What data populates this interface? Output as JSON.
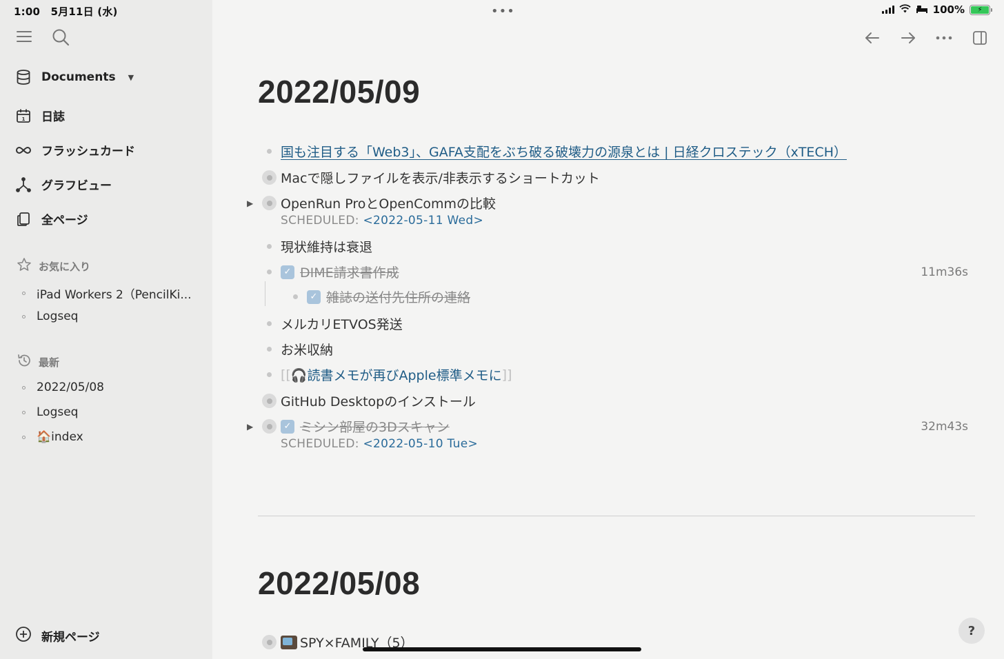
{
  "status_bar": {
    "time": "1:00",
    "date": "5月11日 (水)",
    "battery": "100%"
  },
  "sidebar": {
    "documents": "Documents",
    "nav": [
      {
        "label": "日誌",
        "icon": "calendar-icon"
      },
      {
        "label": "フラッシュカード",
        "icon": "infinity-icon"
      },
      {
        "label": "グラフビュー",
        "icon": "graph-icon"
      },
      {
        "label": "全ページ",
        "icon": "pages-icon"
      }
    ],
    "favorites": {
      "heading": "お気に入り",
      "items": [
        "iPad Workers 2（PencilKi...",
        "Logseq"
      ]
    },
    "recent": {
      "heading": "最新",
      "items": [
        "2022/05/08",
        "Logseq",
        "🏠index"
      ]
    },
    "new_page": "新規ページ"
  },
  "journals": [
    {
      "title": "2022/05/09",
      "blocks": [
        {
          "text": "国も注目する「Web3」、GAFA支配をぶち破る破壊力の源泉とは | 日経クロステック（xTECH）",
          "type": "link"
        },
        {
          "text": "Macで隠しファイルを表示/非表示するショートカット",
          "type": "collapsed"
        },
        {
          "text": "OpenRun ProとOpenCommの比較",
          "type": "collapsed",
          "scheduled_label": "SCHEDULED:",
          "scheduled_date": "<2022-05-11 Wed>"
        },
        {
          "text": "現状維持は衰退"
        },
        {
          "text": "DIME請求書作成",
          "type": "done",
          "timer": "11m36s"
        },
        {
          "text": "雑誌の送付先住所の連絡",
          "type": "done-child"
        },
        {
          "text": "メルカリETVOS発送"
        },
        {
          "text": "お米収納"
        },
        {
          "text": "🎧読書メモが再びApple標準メモに",
          "type": "pageref"
        },
        {
          "text": "GitHub Desktopのインストール",
          "type": "collapsed"
        },
        {
          "text": "ミシン部屋の3Dスキャン",
          "type": "done-collapsed",
          "timer": "32m43s",
          "scheduled_label": "SCHEDULED:",
          "scheduled_date": "<2022-05-10 Tue>"
        }
      ]
    },
    {
      "title": "2022/05/08",
      "blocks": [
        {
          "text": "SPY×FAMILY（5）",
          "type": "collapsed"
        }
      ]
    }
  ],
  "help": "?"
}
